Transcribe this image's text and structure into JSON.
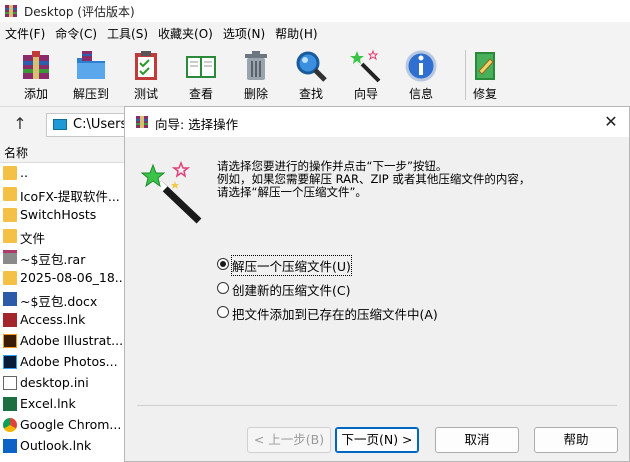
{
  "window": {
    "title": "Desktop (评估版本)"
  },
  "menu": [
    "文件(F)",
    "命令(C)",
    "工具(S)",
    "收藏夹(O)",
    "选项(N)",
    "帮助(H)"
  ],
  "toolbar": {
    "add": "添加",
    "extract": "解压到",
    "test": "测试",
    "view": "查看",
    "delete": "删除",
    "find": "查找",
    "wizard": "向导",
    "info": "信息",
    "repair": "修复"
  },
  "address": {
    "path": "C:\\Users\\"
  },
  "list": {
    "col_name": "名称",
    "rows": [
      {
        "name": "..",
        "type": "folder"
      },
      {
        "name": "IcoFX-提取软件...",
        "type": "folder"
      },
      {
        "name": "SwitchHosts",
        "type": "folder"
      },
      {
        "name": "文件",
        "type": "folder"
      },
      {
        "name": "~$豆包.rar",
        "type": "rar"
      },
      {
        "name": "2025-08-06_18...",
        "type": "folder"
      },
      {
        "name": "~$豆包.docx",
        "type": "word"
      },
      {
        "name": "Access.lnk",
        "type": "access"
      },
      {
        "name": "Adobe Illustrat...",
        "type": "ai"
      },
      {
        "name": "Adobe Photos...",
        "type": "ps"
      },
      {
        "name": "desktop.ini",
        "type": "ini"
      },
      {
        "name": "Excel.lnk",
        "type": "excel"
      },
      {
        "name": "Google Chrom...",
        "type": "chrome"
      },
      {
        "name": "Outlook.lnk",
        "type": "outlook"
      }
    ]
  },
  "dialog": {
    "title": "向导: 选择操作",
    "desc": [
      "请选择您要进行的操作并点击“下一步”按钮。",
      "例如，如果您需要解压 RAR、ZIP 或者其他压缩文件的内容，",
      "请选择“解压一个压缩文件”。"
    ],
    "options": [
      {
        "label": "解压一个压缩文件(U)",
        "selected": true
      },
      {
        "label": "创建新的压缩文件(C)",
        "selected": false
      },
      {
        "label": "把文件添加到已存在的压缩文件中(A)",
        "selected": false
      }
    ],
    "buttons": {
      "back": "< 上一步(B)",
      "next": "下一页(N) >",
      "cancel": "取消",
      "help": "帮助"
    }
  }
}
